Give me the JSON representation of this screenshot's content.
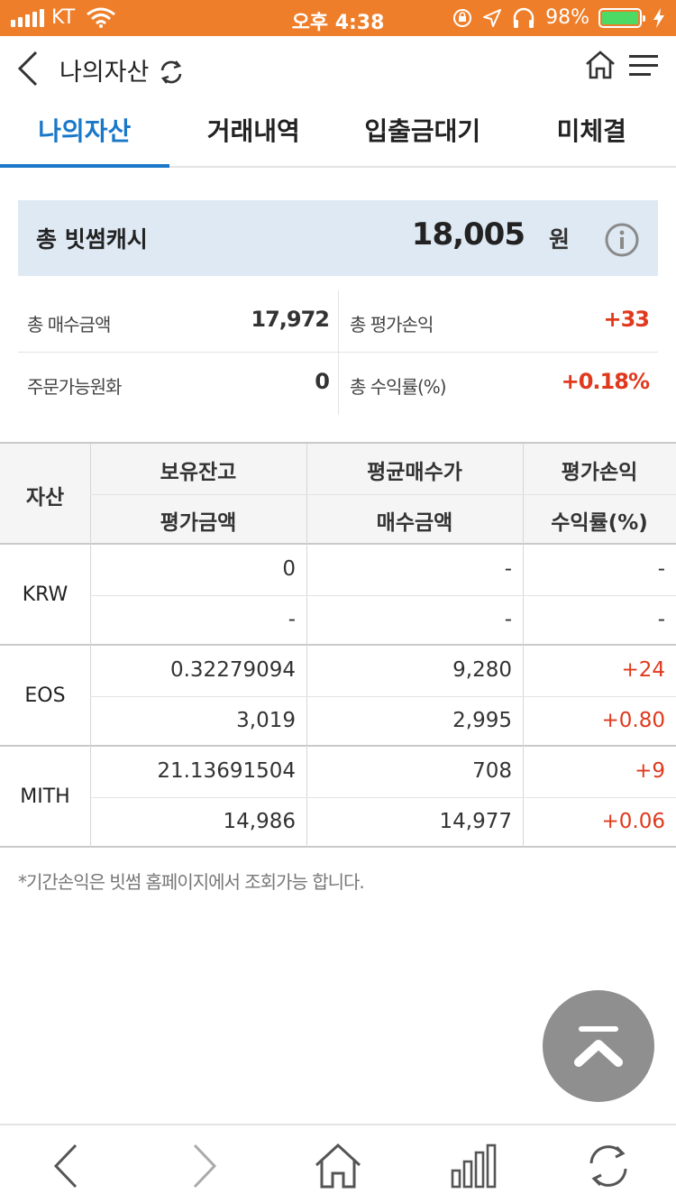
{
  "status_bar": {
    "carrier": "KT",
    "time": "오후 4:38",
    "battery": "98%",
    "battery_level": 0.98,
    "colors": {
      "background": "#ee7e2a",
      "battery": "#4cd964"
    },
    "icons": [
      "signal-icon",
      "wifi-icon",
      "rotation-lock-icon",
      "location-arrow-icon",
      "headphones-icon",
      "battery-icon",
      "charging-bolt-icon"
    ]
  },
  "header": {
    "title": "나의자산",
    "icons": [
      "back-arrow-icon",
      "refresh-icon",
      "home-icon",
      "menu-icon"
    ]
  },
  "tabs": [
    {
      "label": "나의자산",
      "active": true
    },
    {
      "label": "거래내역",
      "active": false
    },
    {
      "label": "입출금대기",
      "active": false
    },
    {
      "label": "미체결",
      "active": false
    }
  ],
  "cash": {
    "label": "총 빗썸캐시",
    "amount": "18,005",
    "unit": "원",
    "icon": "info-icon"
  },
  "summary": {
    "total_buy_label": "총 매수금액",
    "total_buy_value": "17,972",
    "total_eval_pl_label": "총 평가손익",
    "total_eval_pl_value": "+33",
    "available_krw_label": "주문가능원화",
    "available_krw_value": "0",
    "total_return_label": "총 수익률(%)",
    "total_return_value": "+0.18%"
  },
  "table": {
    "headers": {
      "asset": "자산",
      "holding": "보유잔고",
      "eval_amount": "평가금액",
      "avg_buy_price": "평균매수가",
      "buy_amount": "매수금액",
      "eval_pl": "평가손익",
      "return_rate": "수익률(%)"
    },
    "rows": [
      {
        "asset": "KRW",
        "holding": "0",
        "avg_buy_price": "-",
        "eval_pl": "-",
        "eval_amount": "-",
        "buy_amount": "-",
        "return_rate": "-"
      },
      {
        "asset": "EOS",
        "holding": "0.32279094",
        "avg_buy_price": "9,280",
        "eval_pl": "+24",
        "eval_amount": "3,019",
        "buy_amount": "2,995",
        "return_rate": "+0.80"
      },
      {
        "asset": "MITH",
        "holding": "21.13691504",
        "avg_buy_price": "708",
        "eval_pl": "+9",
        "eval_amount": "14,986",
        "buy_amount": "14,977",
        "return_rate": "+0.06"
      }
    ]
  },
  "note": "*기간손익은 빗썸 홈페이지에서 조회가능 합니다.",
  "colors": {
    "accent": "#1a78c9",
    "positive": "#e03a1e",
    "cash_background": "#dfe9f3",
    "scroll_button": "#8f8f8f"
  },
  "scroll_top_icon": "double-chevron-up-icon",
  "toolbar": {
    "icons": [
      "back-icon",
      "forward-icon",
      "home-icon",
      "chart-icon",
      "reload-icon"
    ]
  }
}
